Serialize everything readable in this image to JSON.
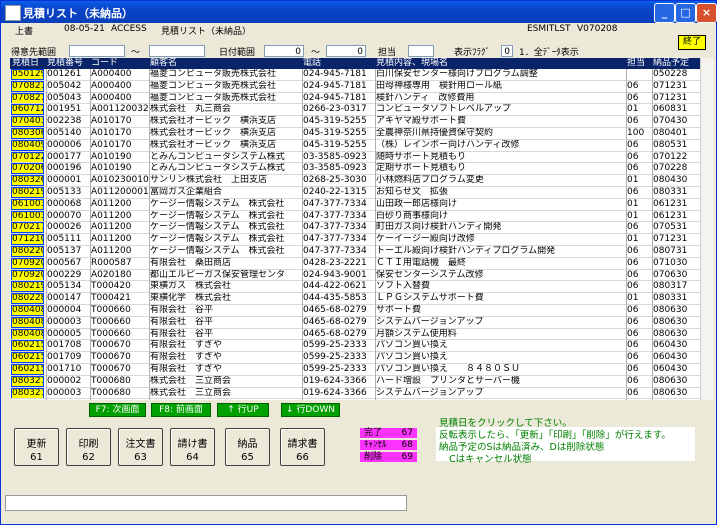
{
  "window": {
    "title": "見積リスト（未納品）"
  },
  "header": {
    "company": "上書",
    "date": "08-05-21",
    "source": "ACCESS",
    "report": "見積リスト（未納品）",
    "program": "ESMITLST",
    "version": "V070208"
  },
  "exit_label": "終了",
  "filters": {
    "customer_label": "得意先範囲",
    "customer_sep": "～",
    "date_label": "日付範囲",
    "date_from": "0",
    "date_sep": "～",
    "date_to": "0",
    "person_label": "担当",
    "person_value": "",
    "flag_label": "表示ﾌﾗｸﾞ",
    "flag_value": "0",
    "flag_desc": "1．全ﾃﾞｰﾀ表示"
  },
  "columns": {
    "date": "見積日",
    "number": "見積番号",
    "code": "コード",
    "customer": "顧客名",
    "phone": "電話",
    "content": "見積内容、現場名",
    "person": "担当",
    "delivery": "納品予定"
  },
  "rows": [
    {
      "date": "050129",
      "no": "001261",
      "code": "A000400",
      "customer": "福菱コンピュータ販売株式会社",
      "phone": "024-945-7181",
      "content": "白川保安センター様向けプログラム調整",
      "person": "",
      "delivery": "050228"
    },
    {
      "date": "070821",
      "no": "005042",
      "code": "A000400",
      "customer": "福菱コンピュータ販売株式会社",
      "phone": "024-945-7181",
      "content": "田母神様専用　検針用ロール紙",
      "person": "06",
      "delivery": "071231"
    },
    {
      "date": "070821",
      "no": "005043",
      "code": "A000400",
      "customer": "福菱コンピュータ販売株式会社",
      "phone": "024-945-7181",
      "content": "検針ハンディ　改修費用",
      "person": "06",
      "delivery": "071231"
    },
    {
      "date": "060712",
      "no": "001951",
      "code": "A001120032",
      "customer": "株式会社　丸三商会",
      "phone": "0266-23-0317",
      "content": "コンピュータソフトレベルアップ",
      "person": "01",
      "delivery": "060831"
    },
    {
      "date": "070403",
      "no": "002238",
      "code": "A010170",
      "customer": "株式会社オービック　横浜支店",
      "phone": "045-319-5255",
      "content": "アキヤマ殿サポート費",
      "person": "06",
      "delivery": "070430"
    },
    {
      "date": "080306",
      "no": "005140",
      "code": "A010170",
      "customer": "株式会社オービック　横浜支店",
      "phone": "045-319-5255",
      "content": "全農神奈川県持優資保守契約",
      "person": "100",
      "delivery": "080401"
    },
    {
      "date": "080409",
      "no": "000006",
      "code": "A010170",
      "customer": "株式会社オービック　横浜支店",
      "phone": "045-319-5255",
      "content": "（株）レインボー向けハンディ改修",
      "person": "06",
      "delivery": "080531"
    },
    {
      "date": "070122",
      "no": "000177",
      "code": "A010190",
      "customer": "とみんコンピュータシステム株式",
      "phone": "03-3585-0923",
      "content": "随時サポート見積もり",
      "person": "06",
      "delivery": "070122"
    },
    {
      "date": "070206",
      "no": "000196",
      "code": "A010190",
      "customer": "とみんコンピュータシステム株式",
      "phone": "03-3585-0923",
      "content": "定期サポート見積もり",
      "person": "06",
      "delivery": "070228"
    },
    {
      "date": "080326",
      "no": "000001",
      "code": "A010230010",
      "customer": "サンリン株式会社　上田支店",
      "phone": "0268-25-3030",
      "content": "小林燃料店プログラム変更",
      "person": "01",
      "delivery": "080430"
    },
    {
      "date": "080219",
      "no": "005133",
      "code": "A011200001",
      "customer": "富岡ガス企業組合",
      "phone": "0240-22-1315",
      "content": "お知らせ文　拡張",
      "person": "06",
      "delivery": "080331"
    },
    {
      "date": "061003",
      "no": "000068",
      "code": "A011200",
      "customer": "ケージー情報システム　株式会社",
      "phone": "047-377-7334",
      "content": "山田政一郎店様向け",
      "person": "01",
      "delivery": "061231"
    },
    {
      "date": "061003",
      "no": "000070",
      "code": "A011200",
      "customer": "ケージー情報システム　株式会社",
      "phone": "047-377-7334",
      "content": "白砂り商事様向け",
      "person": "01",
      "delivery": "061231"
    },
    {
      "date": "070217",
      "no": "000026",
      "code": "A011200",
      "customer": "ケージー情報システム　株式会社",
      "phone": "047-377-7334",
      "content": "町田ガス向け検針ハンディ開発",
      "person": "06",
      "delivery": "070531"
    },
    {
      "date": "071210",
      "no": "005111",
      "code": "A011200",
      "customer": "ケージー情報システム　株式会社",
      "phone": "047-377-7334",
      "content": "ケーイージー殿向け改修",
      "person": "01",
      "delivery": "071231"
    },
    {
      "date": "080220",
      "no": "005137",
      "code": "A011200",
      "customer": "ケージー情報システム　株式会社",
      "phone": "047-377-7334",
      "content": "トーエル殿向け検針ハンディプログラム開発",
      "person": "06",
      "delivery": "080731"
    },
    {
      "date": "070920",
      "no": "000567",
      "code": "R000587",
      "customer": "有限会社　桑田商店",
      "phone": "0428-23-2221",
      "content": "ＣＴＩ用電話機　最終",
      "person": "06",
      "delivery": "071030"
    },
    {
      "date": "070920",
      "no": "000229",
      "code": "A020180",
      "customer": "都山エルピーガス保安管理センタ",
      "phone": "024-943-9001",
      "content": "保安センターシステム改修",
      "person": "06",
      "delivery": "070630"
    },
    {
      "date": "080219",
      "no": "005134",
      "code": "T000420",
      "customer": "東横ガス　株式会社",
      "phone": "044-422-0621",
      "content": "ソフト入替費",
      "person": "06",
      "delivery": "080317"
    },
    {
      "date": "080228",
      "no": "000147",
      "code": "T000421",
      "customer": "東横化学　株式会社",
      "phone": "044-435-5853",
      "content": "ＬＰＧシステムサポート費",
      "person": "01",
      "delivery": "080331"
    },
    {
      "date": "080408",
      "no": "000004",
      "code": "T000660",
      "customer": "有限会社　谷平",
      "phone": "0465-68-0279",
      "content": "サポート費",
      "person": "06",
      "delivery": "080630"
    },
    {
      "date": "080408",
      "no": "000003",
      "code": "T000660",
      "customer": "有限会社　谷平",
      "phone": "0465-68-0279",
      "content": "システムバージョンアップ",
      "person": "06",
      "delivery": "080630"
    },
    {
      "date": "080408",
      "no": "000005",
      "code": "T000660",
      "customer": "有限会社　谷平",
      "phone": "0465-68-0279",
      "content": "月額システム使用料",
      "person": "06",
      "delivery": "080630"
    },
    {
      "date": "060215",
      "no": "001708",
      "code": "T000670",
      "customer": "有限会社　すぎや",
      "phone": "0599-25-2333",
      "content": "パソコン買い換え",
      "person": "06",
      "delivery": "060430"
    },
    {
      "date": "060215",
      "no": "001709",
      "code": "T000670",
      "customer": "有限会社　すぎや",
      "phone": "0599-25-2333",
      "content": "パソコン買い換え",
      "person": "06",
      "delivery": "060430"
    },
    {
      "date": "060215",
      "no": "001710",
      "code": "T000670",
      "customer": "有限会社　すぎや",
      "phone": "0599-25-2333",
      "content": "パソコン買い換え　　８４８０ＳＵ",
      "person": "06",
      "delivery": "060430"
    },
    {
      "date": "080321",
      "no": "000002",
      "code": "T000680",
      "customer": "株式会社　三立商会",
      "phone": "019-624-3366",
      "content": "ハード増設　プリンタとサーバー機",
      "person": "06",
      "delivery": "080630"
    },
    {
      "date": "080321",
      "no": "000003",
      "code": "T000680",
      "customer": "株式会社　三立商会",
      "phone": "019-624-3366",
      "content": "システムバージョンアップ",
      "person": "06",
      "delivery": "080630"
    }
  ],
  "nav": {
    "next": "F7: 次画面",
    "prev": "F8: 前画面",
    "up": "↑ 行UP",
    "down": "↓ 行DOWN"
  },
  "buttons": [
    {
      "label": "更新",
      "key": "61"
    },
    {
      "label": "印刷",
      "key": "62"
    },
    {
      "label": "注文書",
      "key": "63"
    },
    {
      "label": "請け書",
      "key": "64"
    },
    {
      "label": "納品",
      "key": "65"
    },
    {
      "label": "請求書",
      "key": "66"
    }
  ],
  "legend": [
    {
      "label": "完了",
      "key": "67"
    },
    {
      "label": "ｷｬﾝｾﾙ",
      "key": "68"
    },
    {
      "label": "削除",
      "key": "69"
    }
  ],
  "notes": {
    "line1": "見積日をクリックして下さい。",
    "line2": "反転表示したら、「更新」「印刷」「削除」が行えます。",
    "line3": "納品予定のSは納品済み、Dは削除状態",
    "line4": "Cはキャンセル状態"
  },
  "colors": {
    "title_bar": "#0842c8",
    "date_cell": "#ffff00",
    "nav_button": "#00a000",
    "legend": "#ff33ff",
    "note_text": "#008000",
    "grid_header": "#0a246a"
  }
}
